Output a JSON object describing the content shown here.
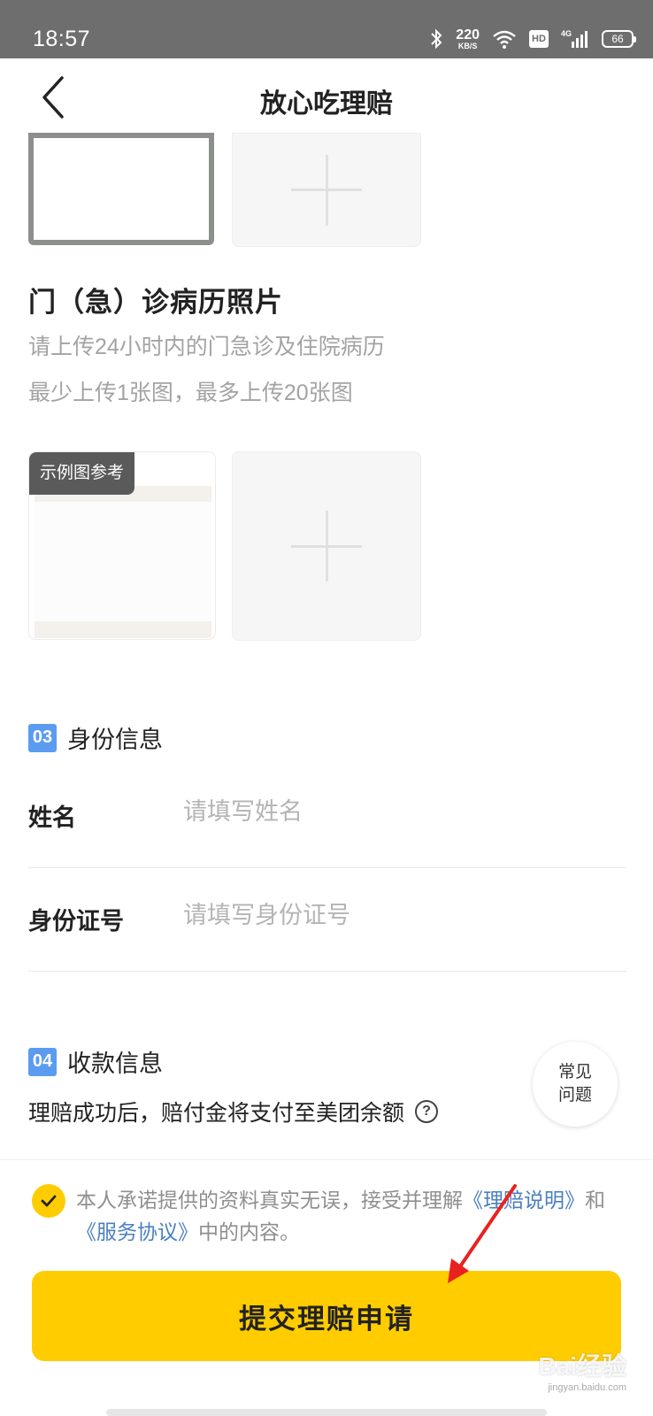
{
  "status_bar": {
    "time": "18:57",
    "network_speed": "220",
    "network_unit": "KB/S",
    "hd": "HD",
    "signal_type": "4G",
    "battery": "66",
    "icons": [
      "bluetooth-icon",
      "wifi-icon",
      "signal-icon",
      "battery-icon"
    ]
  },
  "nav": {
    "title": "放心吃理赔",
    "back_icon": "chevron-left-icon"
  },
  "medical_records": {
    "title": "门（急）诊病历照片",
    "hint_line1": "请上传24小时内的门急诊及住院病历",
    "hint_line2": "最少上传1张图，最多上传20张图",
    "sample_tag": "示例图参考"
  },
  "identity": {
    "step_num": "03",
    "step_label": "身份信息",
    "name_label": "姓名",
    "name_placeholder": "请填写姓名",
    "id_label": "身份证号",
    "id_placeholder": "请填写身份证号"
  },
  "payment": {
    "step_num": "04",
    "step_label": "收款信息",
    "description": "理赔成功后，赔付金将支付至美团余额",
    "help_icon": "question-icon"
  },
  "faq": {
    "line1": "常见",
    "line2": "问题"
  },
  "agreement": {
    "text1": "本人承诺提供的资料真实无误，接受并理解",
    "link1": "《理赔说明》",
    "text2": "和",
    "link2": "《服务协议》",
    "text3": "中的内容。"
  },
  "submit_label": "提交理赔申请",
  "watermark": {
    "main": "Bai经验",
    "sub": "jingyan.baidu.com"
  },
  "colors": {
    "accent": "#ffcc00",
    "step_badge": "#5b9cf0",
    "link": "#4a7fc0",
    "status_bar": "#6e6e6e"
  }
}
